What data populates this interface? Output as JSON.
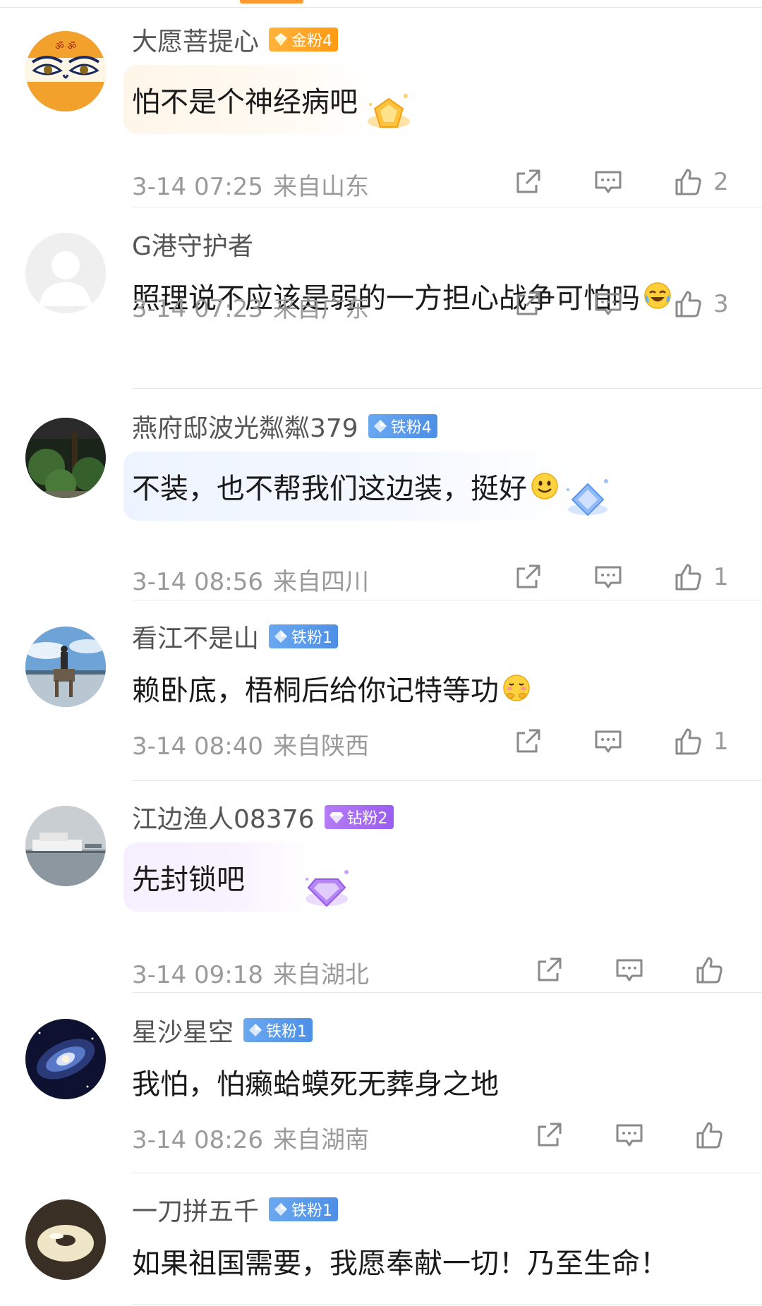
{
  "comments": [
    {
      "name": "大愿菩提心",
      "badge": "金粉4",
      "badge_type": "gold",
      "text": "怕不是个神经病吧",
      "time": "3-14 07:25",
      "location": "来自山东",
      "likes": "2",
      "emoji": "",
      "bubble": true
    },
    {
      "name": "G港守护者",
      "badge": "",
      "badge_type": "",
      "text": "照理说不应该是弱的一方担心战争可怕吗",
      "time": "3-14 07:23",
      "location": "来自广东",
      "likes": "3",
      "emoji": "laugh-cry",
      "bubble": false
    },
    {
      "name": "燕府邸波光粼粼379",
      "badge": "铁粉4",
      "badge_type": "iron",
      "text": "不装，也不帮我们这边装，挺好",
      "time": "3-14 08:56",
      "location": "来自四川",
      "likes": "1",
      "emoji": "smile",
      "bubble": true
    },
    {
      "name": "看江不是山",
      "badge": "铁粉1",
      "badge_type": "iron",
      "text": "赖卧底，梧桐后给你记特等功",
      "time": "3-14 08:40",
      "location": "来自陕西",
      "likes": "1",
      "emoji": "blush-hands",
      "bubble": false
    },
    {
      "name": "江边渔人08376",
      "badge": "钻粉2",
      "badge_type": "diamond",
      "text": "先封锁吧",
      "time": "3-14 09:18",
      "location": "来自湖北",
      "likes": "",
      "emoji": "",
      "bubble": true
    },
    {
      "name": "星沙星空",
      "badge": "铁粉1",
      "badge_type": "iron",
      "text": "我怕，怕癞蛤蟆死无葬身之地",
      "time": "3-14 08:26",
      "location": "来自湖南",
      "likes": "",
      "emoji": "",
      "bubble": false
    },
    {
      "name": "一刀拼五千",
      "badge": "铁粉1",
      "badge_type": "iron",
      "text": "如果祖国需要，我愿奉献一切！乃至生命！",
      "time": "",
      "location": "",
      "likes": "",
      "emoji": "",
      "bubble": false
    }
  ],
  "icons": {
    "share": "share-icon",
    "reply": "comment-icon",
    "like": "thumbs-up-icon"
  },
  "colors": {
    "gold_badge": "#ff9a12",
    "iron_badge": "#4d8fe6",
    "diamond_badge": "#9a5ef0",
    "meta_text": "#9a9a9a"
  }
}
